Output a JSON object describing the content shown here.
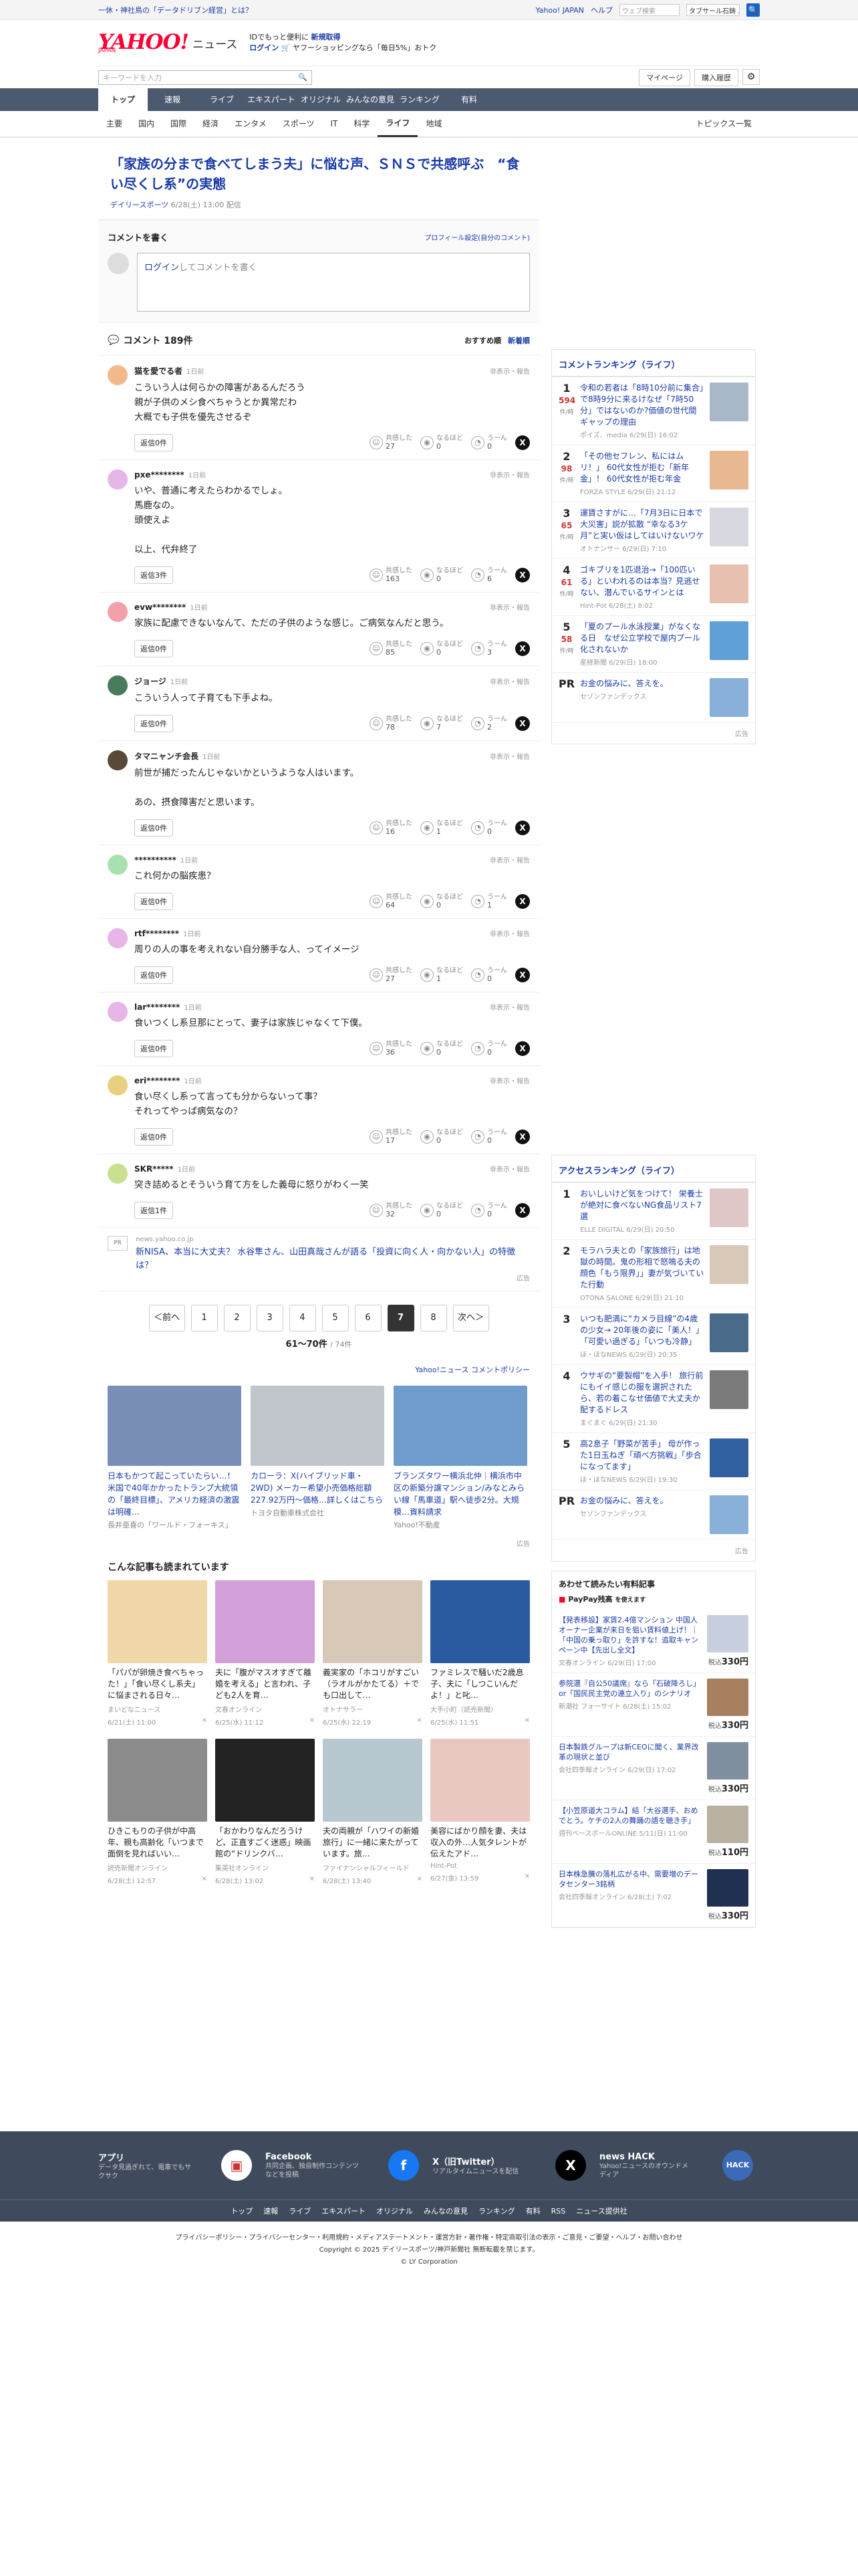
{
  "topbar": {
    "notice": "一休・神社鳥の「データドリブン経営」とは？",
    "links": [
      "Yahoo! JAPAN",
      "ヘルプ"
    ],
    "search_placeholder": "ウェブ検索",
    "search_value": "タブサール石鋳 ...",
    "search_btn": "🔍"
  },
  "masthead": {
    "logo": "YAHOO!",
    "logo_sub": "JAPAN",
    "brand": "ニュース",
    "promo1": "IDでもっと便利に",
    "promo1b": "新規取得",
    "promo2a": "ログイン",
    "promo2b": "ヤフーショッピングなら「毎日5%」おトク"
  },
  "search": {
    "placeholder": "キーワードを入力",
    "mypage": "マイページ",
    "history": "購入履歴"
  },
  "gnav": [
    "トップ",
    "速報",
    "ライブ",
    "エキスパート",
    "オリジナル",
    "みんなの意見",
    "ランキング",
    "有料"
  ],
  "subnav": [
    "主要",
    "国内",
    "国際",
    "経済",
    "エンタメ",
    "スポーツ",
    "IT",
    "科学",
    "ライフ",
    "地域"
  ],
  "subnav_topics": "トピックス一覧",
  "article": {
    "title": "「家族の分まで食べてしまう夫」に悩む声、ＳＮＳで共感呼ぶ　“食い尽くし系”の実態",
    "source": "デイリースポーツ",
    "date": "6/28(土) 13:00 配信"
  },
  "post": {
    "title": "コメントを書く",
    "profile_link": "プロフィール設定(自分のコメント)",
    "login": "ログイン",
    "placeholder": "してコメントを書く"
  },
  "comments_head": {
    "title": "コメント 189件",
    "sort1": "おすすめ順",
    "sort2": "新着順"
  },
  "comments": [
    {
      "name": "猫を愛でる者",
      "ago": "1日前",
      "text": "こういう人は何らかの障害があるんだろう\n親が子供のメシ食べちゃうとか異常だわ\n大概でも子供を優先させるぞ",
      "reply": "返信0件",
      "a": "27",
      "b": "0",
      "c": "0",
      "color": "#f3b98d"
    },
    {
      "name": "pxe********",
      "ago": "1日前",
      "text": "いや、普通に考えたらわかるでしょ。\n馬鹿なの。\n頭使えよ\n\n以上、代弁終了",
      "reply": "返信3件",
      "a": "163",
      "b": "0",
      "c": "6",
      "color": "#e7b6e8"
    },
    {
      "name": "evw********",
      "ago": "1日前",
      "text": "家族に配慮できないなんて、ただの子供のような感じ。ご病気なんだと思う。",
      "reply": "返信0件",
      "a": "85",
      "b": "0",
      "c": "3",
      "color": "#f3a0a8"
    },
    {
      "name": "ジョージ",
      "ago": "1日前",
      "text": "こういう人って子育ても下手よね。",
      "reply": "返信0件",
      "a": "78",
      "b": "7",
      "c": "2",
      "color": "#4a7a5c"
    },
    {
      "name": "タマニャンチ会長",
      "ago": "1日前",
      "text": "前世が捕だったんじゃないかというような人はいます。\n\nあの、摂食障害だと思います。",
      "reply": "返信0件",
      "a": "16",
      "b": "1",
      "c": "0",
      "color": "#5a4838"
    },
    {
      "name": "**********",
      "ago": "1日前",
      "text": "これ何かの脳疾患？",
      "reply": "返信0件",
      "a": "64",
      "b": "0",
      "c": "1",
      "color": "#a8e0b0"
    },
    {
      "name": "rtf********",
      "ago": "1日前",
      "text": "周りの人の事を考えれない自分勝手な人、ってイメージ",
      "reply": "返信0件",
      "a": "27",
      "b": "1",
      "c": "0",
      "color": "#e7b6e8"
    },
    {
      "name": "lar********",
      "ago": "1日前",
      "text": "食いつくし系旦那にとって、妻子は家族じゃなくて下僕。",
      "reply": "返信0件",
      "a": "36",
      "b": "0",
      "c": "0",
      "color": "#e7b6e8"
    },
    {
      "name": "eri********",
      "ago": "1日前",
      "text": "食い尽くし系って言っても分からないって事？\nそれってやっぱ病気なの？",
      "reply": "返信0件",
      "a": "17",
      "b": "0",
      "c": "0",
      "color": "#e8d080"
    },
    {
      "name": "SKR*****",
      "ago": "1日前",
      "text": "突き詰めるとそういう育て方をした義母に怒りがわく一笑",
      "reply": "返信1件",
      "a": "32",
      "b": "0",
      "c": "0",
      "color": "#c8e090"
    }
  ],
  "reactions": {
    "a": "共感した",
    "b": "なるほど",
    "c": "うーん"
  },
  "hide_report": "非表示・報告",
  "comment_ad": {
    "pr": "PR",
    "src": "news.yahoo.co.jp",
    "title": "新NISA、本当に大丈夫？ 水谷隼さん、山田真哉さんが語る「投資に向く人・向かない人」の特徴は？",
    "label": "広告"
  },
  "pager": {
    "prev": "＜前へ",
    "pages": [
      "1",
      "2",
      "3",
      "4",
      "5",
      "6",
      "7",
      "8"
    ],
    "current": "7",
    "next": "次へ＞",
    "info": "61〜70件",
    "total": "/ 74件"
  },
  "policy": "Yahoo!ニュース コメントポリシー",
  "ads": [
    {
      "t": "日本もかつて起こっていたらい…！米国で40年かかったトランプ大統領の「最終目標」、アメリカ経済の激震は明確…",
      "s": "長井亜喜の「ワールド・フォーキス」",
      "bg": "#7a8fb8"
    },
    {
      "t": "カローラ：X(ハイブリッド車・2WD) メーカー希望小売価格総額227.92万円〜価格…詳しくはこちら",
      "s": "トヨタ自動車株式会社",
      "bg": "#c0c6cc"
    },
    {
      "t": "ブランズタワー横浜北仲｜横浜市中区の新築分譲マンション/みなとみらい線「馬車道」駅へ徒歩2分。大規模…資料請求",
      "s": "Yahoo!不動産",
      "bg": "#6f9ccc"
    }
  ],
  "ad_label": "広告",
  "reco_head": "こんな記事も読まれています",
  "reco": [
    {
      "t": "「パパが卵焼き食べちゃった！」「食い尽くし系夫」に悩まされる日々…",
      "s": "まいどなニュース",
      "d": "6/21(土) 11:00",
      "bg": "#f1d8a8"
    },
    {
      "t": "夫に「腹がマスオすぎて離婚を考える」と言われ、子ども2人を育…",
      "s": "文春オンライン",
      "d": "6/25(水) 11:12",
      "bg": "#d1a0d8"
    },
    {
      "t": "義実家の「ホコリがすごい（ラオルがかたてる）＋でも口出して…",
      "s": "オトナサラー",
      "d": "6/25(水) 22:19",
      "bg": "#d8c8b8"
    },
    {
      "t": "ファミレスで騒いだ2歳息子、夫に「しつこいんだよ！」と叱…",
      "s": "大手小町（読売新聞）",
      "d": "6/25(水) 11:51",
      "bg": "#2a5aa0"
    },
    {
      "t": "ひきこもりの子供が中高年、親も高齢化「いつまで面倒を見ればいい…",
      "s": "読売新聞オンライン",
      "d": "6/28(土) 12:57",
      "bg": "#8c8c8c"
    },
    {
      "t": "「おかわりなんだろうけど、正直すごく迷惑」映画館の“ドリンクバ…",
      "s": "集英社オンライン",
      "d": "6/28(土) 13:02",
      "bg": "#222"
    },
    {
      "t": "夫の両親が「ハワイの新婚旅行」に一緒に来たがっています。旅…",
      "s": "ファイナンシャルフィールド",
      "d": "6/28(土) 13:40",
      "bg": "#b8c8d0"
    },
    {
      "t": "美容にばかり顔を妻、夫は収入の外…人気タレントが伝えたアド…",
      "s": "Hint-Pot",
      "d": "6/27(金) 13:59",
      "bg": "#e8c8c0"
    }
  ],
  "rank1": {
    "title": "コメントランキング（ライフ）",
    "items": [
      {
        "n": "1",
        "c": "594",
        "u": "件/時",
        "t": "令和の若者は「8時10分前に集合」で8時9分に来るけなぜ「7時50分」ではないのか?価値の世代間ギャップの理由",
        "m": "ポイズ、media 6/29(日) 16:02",
        "bg": "#a8b8c8"
      },
      {
        "n": "2",
        "c": "98",
        "u": "件/時",
        "t": "「その他セフレン、私にはムリ！」 60代女性が拒む「新年金」！ 60代女性が拒む年金",
        "m": "FORZA STYLE 6/29(日) 21:12",
        "bg": "#e8b890"
      },
      {
        "n": "3",
        "c": "65",
        "u": "件/時",
        "t": "運賃さすがに…「7月3日に日本で大災害」説が拡散 “幸なる3ケ月”と実い仮はしてはいけないワケ",
        "m": "オトナンサー 6/29(日) 7:10",
        "bg": "#d8d8e0"
      },
      {
        "n": "4",
        "c": "61",
        "u": "件/時",
        "t": "ゴキブリを1匹退治→「100匹いる」といわれるのは本当？見逃せない、潜んでいるサインとは",
        "m": "Hint-Pot 6/28(土) 8:02",
        "bg": "#e8c0b0"
      },
      {
        "n": "5",
        "c": "58",
        "u": "件/時",
        "t": "「夏のプール水泳授業」がなくなる日　なぜ公立学校で屋内プール化されないか",
        "m": "産経新聞 6/29(日) 18:00",
        "bg": "#60a0d8"
      },
      {
        "n": "PR",
        "c": "",
        "u": "",
        "t": "お金の悩みに、答えを。",
        "m": "セゾンファンデックス",
        "bg": "#88b0d8"
      }
    ]
  },
  "rank2": {
    "title": "アクセスランキング（ライフ）",
    "items": [
      {
        "n": "1",
        "t": "おいしいけど気をつけて！ 栄養士が絶対に食べないNG食品リスト7選",
        "m": "ELLE DIGITAL 6/29(日) 20:50",
        "bg": "#e0c8c8"
      },
      {
        "n": "2",
        "t": "モラハラ夫との「家族旅行」は地獄の時間。鬼の形相で怒鳴る夫の顔色「もう限界」」妻が気づいていた行動",
        "m": "OTONA SALONE 6/29(日) 21:10",
        "bg": "#d8c8b8"
      },
      {
        "n": "3",
        "t": "いつも肥満に“カメラ目線”の4歳の少女→ 20年後の姿に「美人！」「可愛い過ぎる」「いつも冷静」",
        "m": "ほ・ほなNEWS 6/29(日) 20:35",
        "bg": "#4a6a8a"
      },
      {
        "n": "4",
        "t": "ウサギの“要製帽”を入手！ 旅行前にもイイ感じの服を選択されたら、若の着こなせ価値で大丈夫か配するドレス",
        "m": "まぐまぐ 6/29(日) 21:30",
        "bg": "#7a7a7a"
      },
      {
        "n": "5",
        "t": "高2息子「野菜が苦手」 母が作った1日玉ねぎ「頑べ方挑戦」「歩合になってます」",
        "m": "ほ・ほなNEWS 6/29(日) 19:30",
        "bg": "#3060a0"
      },
      {
        "n": "PR",
        "t": "お金の悩みに、答えを。",
        "m": "セゾンファンデックス",
        "bg": "#88b0d8"
      }
    ]
  },
  "ec": {
    "title": "あわせて読みたい有料記事",
    "logo": "PayPay残高",
    "logo_sub": "を使えます",
    "items": [
      {
        "t": "【発表移設】家賃2.4億マンション 中国人オーナー企業が来日を狙い賃料値上げ！｜「中国の乗っ取り」を許すな！追取キャンペーン中【先出し全文】",
        "m": "文春オンライン 6/29(日) 17:00",
        "p": "税込",
        "pr": "330円",
        "bg": "#c8d0e0"
      },
      {
        "t": "参院選『自公50議席』なら「石破降ろし」or「国民民主党の連立入り」のシナリオ",
        "m": "新潮社 フォーサイト 6/28(土) 15:02",
        "p": "税込",
        "pr": "330円",
        "bg": "#a88060"
      },
      {
        "t": "日本製鉄グループは新CEOに聞く、業界改革の現状と並び",
        "m": "会社四季報オンライン 6/29(日) 17:02",
        "p": "税込",
        "pr": "330円",
        "bg": "#8090a0"
      },
      {
        "t": "【小笠原道大コラム】結「大谷選手、おめでとう。ケチの2人の舞踊の語を聴き手」",
        "m": "週刊ベースボールONLINE 5/11(日) 11:00",
        "p": "税込",
        "pr": "110円",
        "bg": "#b8b0a0"
      },
      {
        "t": "日本株急騰の落札広がる中、需要増のデータセンター3銘柄",
        "m": "会社四季報オンライン 6/28(土) 7:02",
        "p": "税込",
        "pr": "330円",
        "bg": "#203050"
      }
    ]
  },
  "footer": {
    "boxes": [
      {
        "t": "アプリ",
        "s": "データ見過ぎれて、電車でもサクサク",
        "ic": "▣",
        "bg": "#fff",
        "fg": "#c33"
      },
      {
        "t": "Facebook",
        "s": "共同企画、独自制作コンテンツなどを投稿",
        "ic": "f",
        "bg": "#1877f2",
        "fg": "#fff"
      },
      {
        "t": "X（旧Twitter）",
        "s": "リアルタイムニュースを配信",
        "ic": "X",
        "bg": "#000",
        "fg": "#fff"
      },
      {
        "t": "news HACK",
        "s": "Yahoo!ニュースのオウンドメディア",
        "ic": "HACK",
        "bg": "#3a6ab8",
        "fg": "#fff"
      }
    ],
    "links": [
      "トップ",
      "速報",
      "ライブ",
      "エキスパート",
      "オリジナル",
      "みんなの意見",
      "ランキング",
      "有料",
      "RSS",
      "ニュース提供社"
    ],
    "legal1": "プライバシーポリシー・プライバシーセンター・利用規約・メディアステートメント・運営方針・著作権・特定商取引法の表示・ご意見・ご要望・ヘルプ・お問い合わせ",
    "legal2": "Copyright © 2025 デイリースポーツ/神戸新聞社 無断転載を禁じます。",
    "legal3": "© LY Corporation"
  }
}
